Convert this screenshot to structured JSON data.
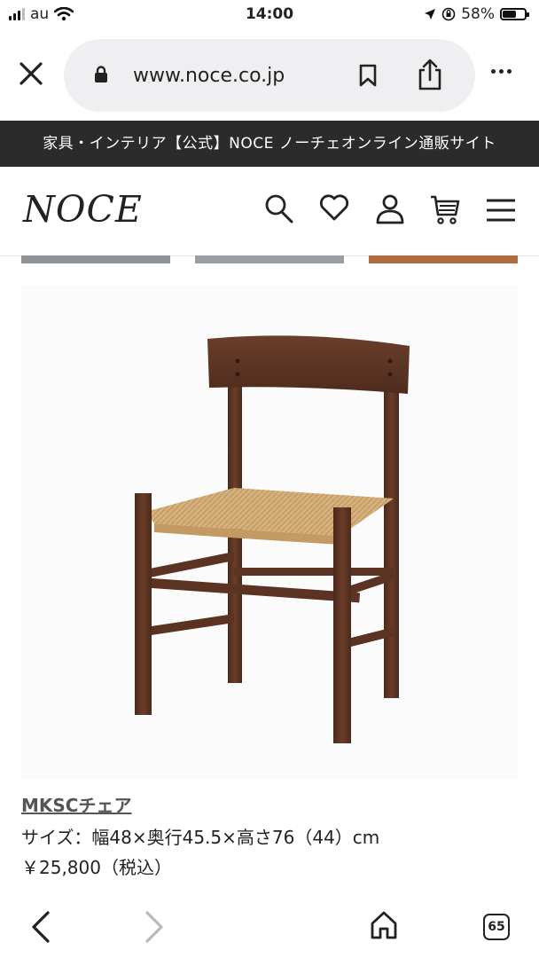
{
  "status_bar": {
    "carrier": "au",
    "time": "14:00",
    "battery_text": "58%",
    "battery_level": 0.58
  },
  "browser": {
    "url": "www.noce.co.jp",
    "icons": [
      "close-icon",
      "lock-icon",
      "bookmark-icon",
      "share-icon",
      "more-icon"
    ]
  },
  "banner": {
    "text": "家具・インテリア【公式】NOCE ノーチェオンライン通販サイト"
  },
  "header": {
    "logo": "NOCE",
    "icons": [
      "search-icon",
      "heart-icon",
      "user-icon",
      "cart-icon",
      "menu-icon"
    ]
  },
  "product": {
    "name": "MKSCチェア",
    "size": "サイズ：幅48×奥行45.5×高さ76（44）cm",
    "price": "￥25,800（税込）"
  },
  "toolbar": {
    "tab_count": "65",
    "icons": [
      "back-icon",
      "forward-icon",
      "home-icon",
      "tabs-icon"
    ]
  },
  "colors": {
    "banner_bg": "#2b2b2b",
    "url_pill_bg": "#efeff1",
    "chair_wood": "#5a3322",
    "chair_seat": "#d6b07a"
  }
}
